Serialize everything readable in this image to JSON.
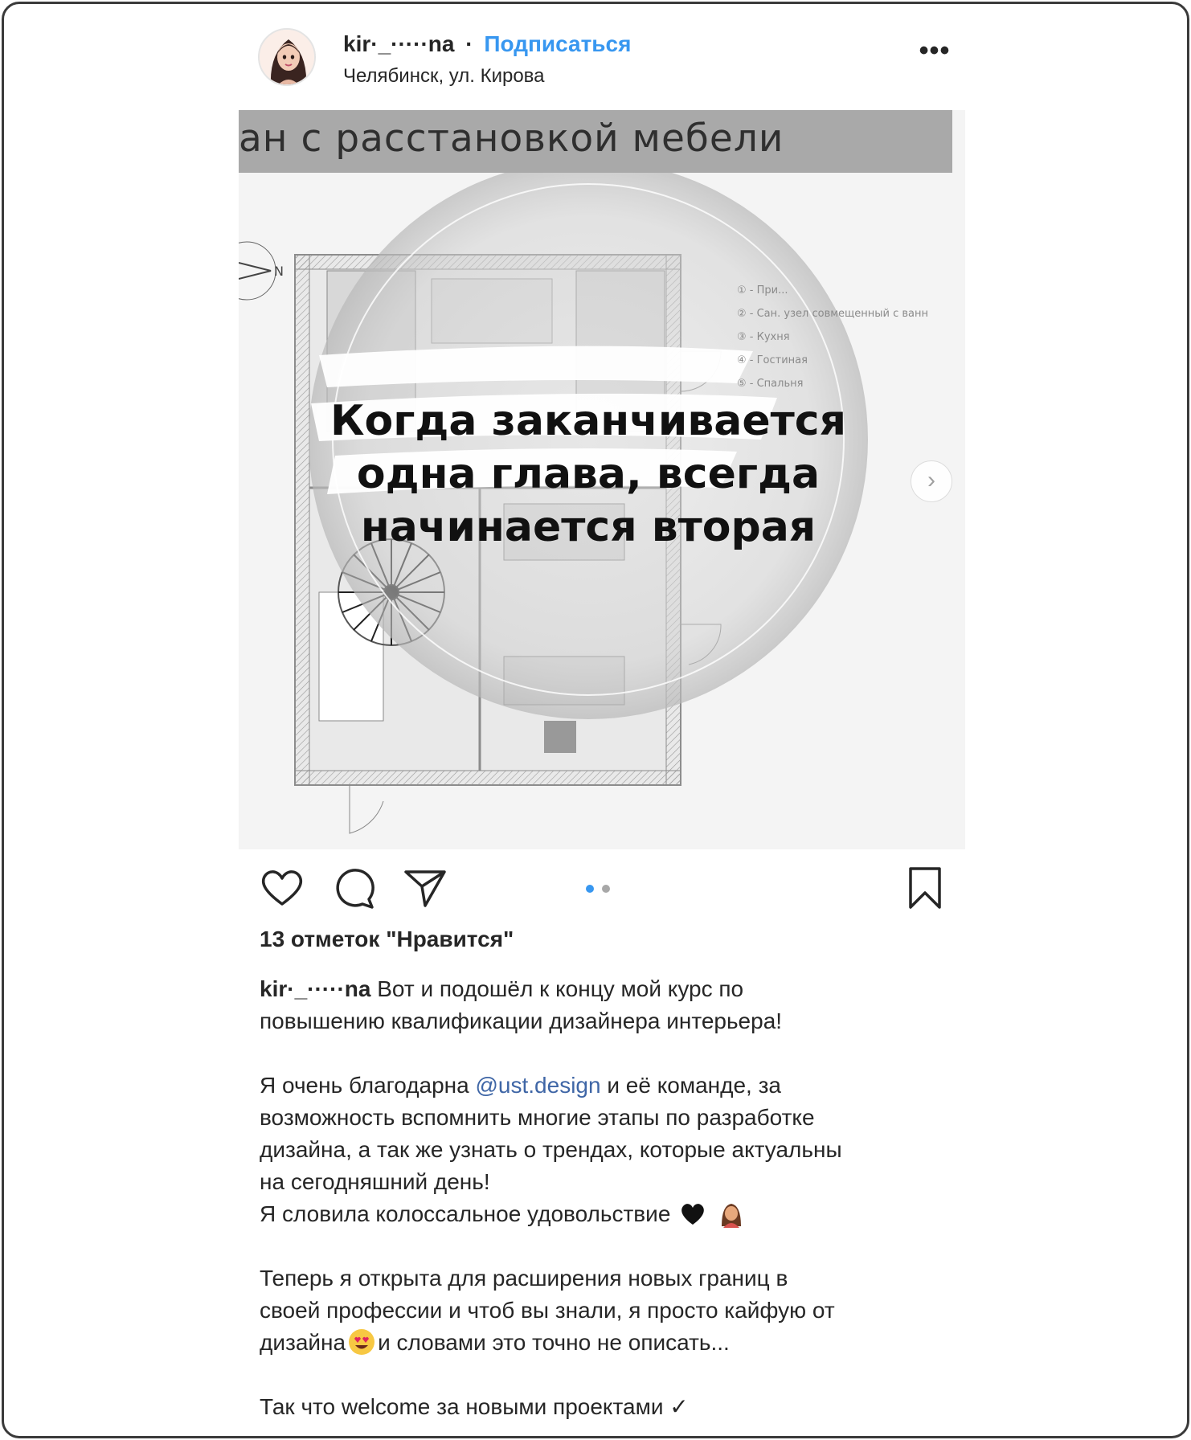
{
  "post": {
    "username": "kir·_·····na",
    "separator": "·",
    "follow_label": "Подписаться",
    "location": "Челябинск, ул. Кирова",
    "more_label": "•••"
  },
  "media": {
    "plan_title": "ан с расстановкой мебели",
    "quote_lines": [
      "Когда заканчивается",
      "одна глава, всегда",
      "начинается вторая"
    ],
    "legend": [
      "① - При...",
      "② - Сан. узел совмещенный с ванн",
      "③ - Кухня",
      "④ - Гостиная",
      "⑤ - Спальня"
    ],
    "next_label": "›",
    "pager_total": 2,
    "pager_active": 1
  },
  "actions": {
    "like_icon": "heart-icon",
    "comment_icon": "comment-icon",
    "share_icon": "paper-plane-icon",
    "save_icon": "bookmark-icon"
  },
  "likes_text": "13 отметок \"Нравится\"",
  "caption": {
    "username": "kir·_·····na",
    "line1_rest": " Вот и подошёл к концу мой курс по",
    "line2": "повышению квалификации дизайнера интерьера!",
    "p2_before_mention": "Я очень благодарна ",
    "mention": "@ust.design",
    "p2_after_mention": " и её команде, за",
    "line4": "возможность вспомнить многие этапы по разработке",
    "line5": "дизайна, а так же узнать о трендах, которые актуальны",
    "line6": "на сегодняшний день!",
    "line7": "Я словила колоссальное удовольствие",
    "line8": "Теперь я открыта для расширения новых границ в",
    "line9": "своей профессии и чтоб вы знали, я просто кайфую от",
    "line10_a": "дизайна",
    "line10_b": "и словами это точно не описать...",
    "line11": "Так что welcome за новыми проектами ✓"
  },
  "colors": {
    "link_blue": "#3897f0",
    "mention_blue": "#3f66a6",
    "pager_active": "#3897f0",
    "pager_inactive": "#a8a8a8"
  }
}
